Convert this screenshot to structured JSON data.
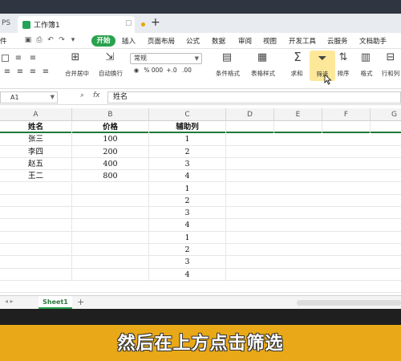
{
  "app": {
    "app_tab": "PS",
    "doc_tab": "工作簿1",
    "new_tab": "+"
  },
  "menu": {
    "left_label": "件",
    "start": "开始",
    "items": [
      "插入",
      "页面布局",
      "公式",
      "数据",
      "审阅",
      "视图",
      "开发工具",
      "云服务",
      "文档助手"
    ]
  },
  "ribbon": {
    "font_combo": "常规",
    "merge": "合并居中",
    "wrap": "自动换行",
    "cond_format": "条件格式",
    "table_style": "表格样式",
    "sum": "求和",
    "filter": "筛选",
    "sort": "排序",
    "format": "格式",
    "rowcol": "行和列",
    "percent": "%",
    "thousands": "000",
    "dec_inc": "+.0",
    "dec_dec": ".00"
  },
  "formula": {
    "cell_ref": "A1",
    "fx": "fx",
    "content": "姓名"
  },
  "columns": [
    "A",
    "B",
    "C",
    "D",
    "E",
    "F",
    "G"
  ],
  "table": {
    "headers": [
      "姓名",
      "价格",
      "辅助列"
    ],
    "rows": [
      [
        "张三",
        "100",
        "1"
      ],
      [
        "李四",
        "200",
        "2"
      ],
      [
        "赵五",
        "400",
        "3"
      ],
      [
        "王二",
        "800",
        "4"
      ],
      [
        "",
        "",
        "1"
      ],
      [
        "",
        "",
        "2"
      ],
      [
        "",
        "",
        "3"
      ],
      [
        "",
        "",
        "4"
      ],
      [
        "",
        "",
        "1"
      ],
      [
        "",
        "",
        "2"
      ],
      [
        "",
        "",
        "3"
      ],
      [
        "",
        "",
        "4"
      ]
    ]
  },
  "sheet": {
    "tab": "Sheet1",
    "add": "+"
  },
  "caption": "然后在上方点击筛选",
  "colors": {
    "accent": "#2aa24e",
    "banner": "#e8a817",
    "filter_highlight": "#fde89a"
  }
}
